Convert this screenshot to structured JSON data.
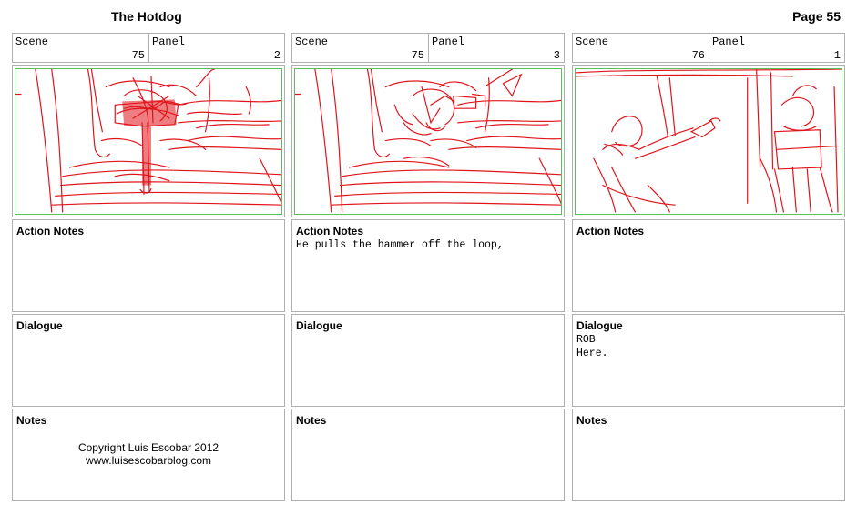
{
  "document": {
    "title": "The Hotdog",
    "page_label": "Page 55"
  },
  "labels": {
    "scene": "Scene",
    "panel": "Panel",
    "action_notes": "Action Notes",
    "dialogue": "Dialogue",
    "notes": "Notes"
  },
  "panels": [
    {
      "scene": "75",
      "panel": "2",
      "action_notes": "",
      "dialogue": "",
      "notes": ""
    },
    {
      "scene": "75",
      "panel": "3",
      "action_notes": "He pulls the hammer off the loop,",
      "dialogue": "",
      "notes": ""
    },
    {
      "scene": "76",
      "panel": "1",
      "action_notes": "",
      "dialogue": "ROB\nHere.",
      "notes": ""
    }
  ],
  "copyright": {
    "line1": "Copyright Luis Escobar 2012",
    "line2": "www.luisescobarblog.com"
  },
  "colors": {
    "sketch": "#e0141a",
    "frame_border": "#58c058",
    "box_border": "#b0b0b0"
  }
}
